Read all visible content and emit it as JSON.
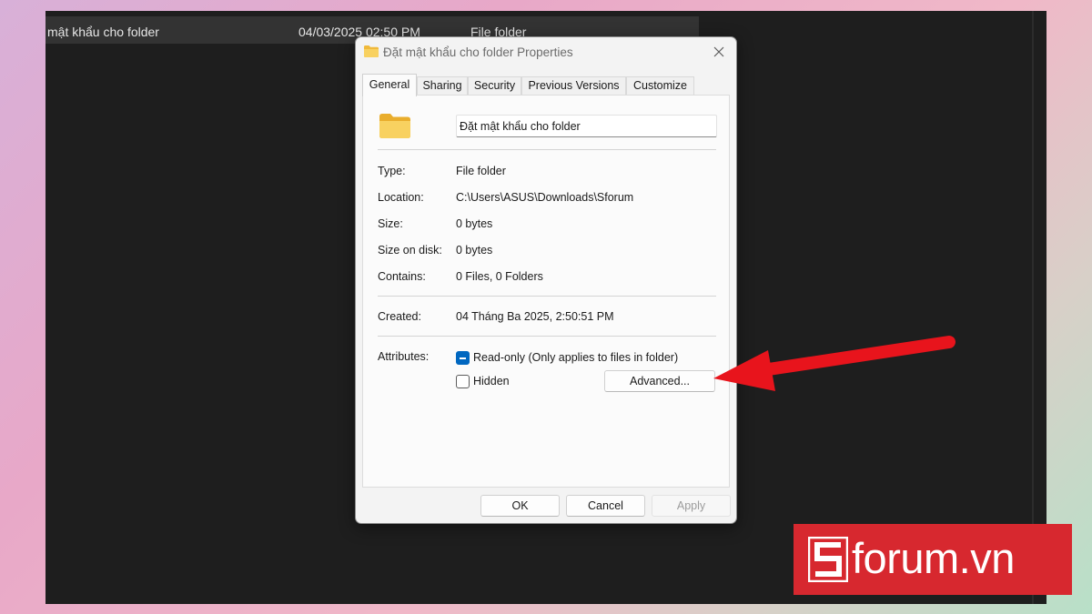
{
  "explorer": {
    "row": {
      "name": "mật khẩu cho folder",
      "date_modified": "04/03/2025 02:50 PM",
      "type": "File folder"
    }
  },
  "dialog": {
    "title": "Đặt mật khẩu cho folder Properties",
    "tabs": [
      "General",
      "Sharing",
      "Security",
      "Previous Versions",
      "Customize"
    ],
    "active_tab": "General",
    "folder_name": "Đặt mật khẩu cho folder",
    "properties": {
      "type": {
        "label": "Type:",
        "value": "File folder"
      },
      "location": {
        "label": "Location:",
        "value": "C:\\Users\\ASUS\\Downloads\\Sforum"
      },
      "size": {
        "label": "Size:",
        "value": "0 bytes"
      },
      "size_on_disk": {
        "label": "Size on disk:",
        "value": "0 bytes"
      },
      "contains": {
        "label": "Contains:",
        "value": "0 Files, 0 Folders"
      },
      "created": {
        "label": "Created:",
        "value": "04 Tháng Ba 2025, 2:50:51 PM"
      }
    },
    "attributes": {
      "label": "Attributes:",
      "readonly": {
        "label": "Read-only (Only applies to files in folder)",
        "state": "indeterminate"
      },
      "hidden": {
        "label": "Hidden",
        "state": "unchecked"
      },
      "advanced_label": "Advanced..."
    },
    "buttons": {
      "ok": "OK",
      "cancel": "Cancel",
      "apply": "Apply"
    }
  },
  "watermark": {
    "text": "forum.vn",
    "mark": "S"
  },
  "colors": {
    "accent": "#0067c0",
    "arrow": "#e8141c",
    "logo_bg": "#d7282f",
    "folder_yellow": "#f8d160"
  }
}
